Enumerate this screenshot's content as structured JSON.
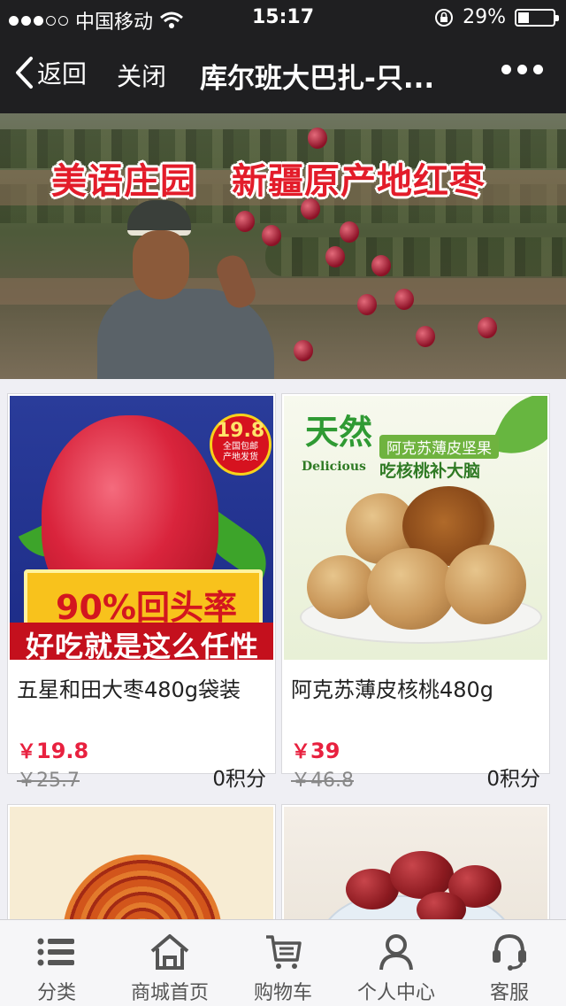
{
  "status_bar": {
    "carrier": "中国移动",
    "time": "15:17",
    "battery": "29%",
    "battery_level": 0.29
  },
  "nav": {
    "back_label": "返回",
    "close_label": "关闭",
    "title": "库尔班大巴扎-只..."
  },
  "banner": {
    "left_text": "美语庄园",
    "right_text": "新疆原产地红枣"
  },
  "products": [
    {
      "name": "五星和田大枣480g袋装",
      "currency": "￥",
      "price": "19.8",
      "old_price": "￥25.7",
      "points": "0积分",
      "image_text": {
        "badge_price": "19.8",
        "badge_line1": "全国包邮",
        "badge_line2": "产地发货",
        "ribbon": "90%回头率",
        "bottom": "好吃就是这么任性"
      }
    },
    {
      "name": "阿克苏薄皮核桃480g",
      "currency": "￥",
      "price": "39",
      "old_price": "￥46.8",
      "points": "0积分",
      "image_text": {
        "big": "天然",
        "tag": "阿克苏薄皮坚果",
        "en": "Delicious",
        "slogan": "吃核桃补大脑"
      }
    }
  ],
  "tabs": [
    {
      "label": "分类",
      "icon": "list-icon"
    },
    {
      "label": "商城首页",
      "icon": "home-icon"
    },
    {
      "label": "购物车",
      "icon": "cart-icon"
    },
    {
      "label": "个人中心",
      "icon": "user-icon"
    },
    {
      "label": "客服",
      "icon": "headset-icon"
    }
  ]
}
